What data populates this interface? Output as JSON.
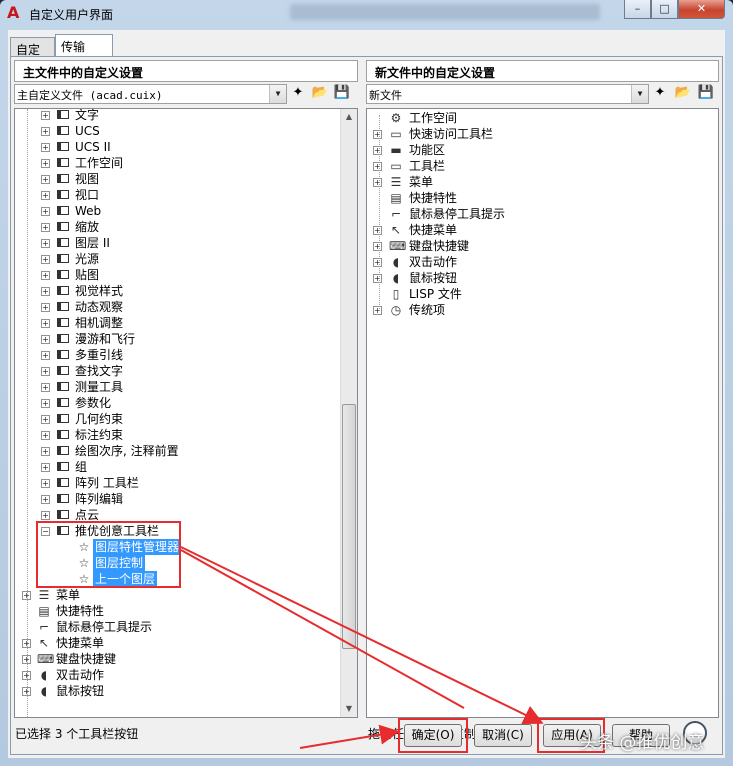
{
  "window": {
    "title": "自定义用户界面",
    "controls": {
      "minimize": "–",
      "maximize": "□",
      "close": "✕"
    }
  },
  "tabs": [
    {
      "label": "自定义",
      "active": false
    },
    {
      "label": "传输",
      "active": true
    }
  ],
  "left": {
    "header": "主文件中的自定义设置",
    "combo_value": "主自定义文件 (acad.cuix)",
    "tree_items": [
      {
        "label": "文字"
      },
      {
        "label": "UCS"
      },
      {
        "label": "UCS II"
      },
      {
        "label": "工作空间"
      },
      {
        "label": "视图"
      },
      {
        "label": "视口"
      },
      {
        "label": "Web"
      },
      {
        "label": "缩放"
      },
      {
        "label": "图层 II"
      },
      {
        "label": "光源"
      },
      {
        "label": "贴图"
      },
      {
        "label": "视觉样式"
      },
      {
        "label": "动态观察"
      },
      {
        "label": "相机调整"
      },
      {
        "label": "漫游和飞行"
      },
      {
        "label": "多重引线"
      },
      {
        "label": "查找文字"
      },
      {
        "label": "测量工具"
      },
      {
        "label": "参数化"
      },
      {
        "label": "几何约束"
      },
      {
        "label": "标注约束"
      },
      {
        "label": "绘图次序, 注释前置"
      },
      {
        "label": "组"
      },
      {
        "label": "阵列 工具栏"
      },
      {
        "label": "阵列编辑"
      },
      {
        "label": "点云"
      },
      {
        "label": "推优创意工具栏"
      }
    ],
    "custom_buttons": [
      {
        "label": "图层特性管理器"
      },
      {
        "label": "图层控制"
      },
      {
        "label": "上一个图层"
      }
    ],
    "bottom_items": [
      {
        "label": "菜单"
      },
      {
        "label": "快捷特性"
      },
      {
        "label": "鼠标悬停工具提示"
      },
      {
        "label": "快捷菜单"
      },
      {
        "label": "键盘快捷键"
      },
      {
        "label": "双击动作"
      },
      {
        "label": "鼠标按钮"
      }
    ],
    "status": "已选择 3 个工具栏按钮"
  },
  "right": {
    "header": "新文件中的自定义设置",
    "combo_value": "新文件",
    "tree_items": [
      {
        "label": "工作空间",
        "icon": "gear-icon",
        "expand": false
      },
      {
        "label": "快速访问工具栏",
        "icon": "toolbar-icon",
        "expand": true
      },
      {
        "label": "功能区",
        "icon": "ribbon-icon",
        "expand": true
      },
      {
        "label": "工具栏",
        "icon": "toolbar-icon",
        "expand": true
      },
      {
        "label": "菜单",
        "icon": "menu-icon",
        "expand": true
      },
      {
        "label": "快捷特性",
        "icon": "properties-icon",
        "expand": false
      },
      {
        "label": "鼠标悬停工具提示",
        "icon": "tooltip-icon",
        "expand": false
      },
      {
        "label": "快捷菜单",
        "icon": "shortcut-menu-icon",
        "expand": true
      },
      {
        "label": "键盘快捷键",
        "icon": "keyboard-icon",
        "expand": true
      },
      {
        "label": "双击动作",
        "icon": "mouse-icon",
        "expand": true
      },
      {
        "label": "鼠标按钮",
        "icon": "mouse-icon",
        "expand": true
      },
      {
        "label": "LISP 文件",
        "icon": "lisp-file-icon",
        "expand": false
      },
      {
        "label": "传统项",
        "icon": "clock-icon",
        "expand": true
      }
    ],
    "status": "拖动任一文件可复制内容"
  },
  "buttons": {
    "ok": "确定(O)",
    "cancel": "取消(C)",
    "apply": "应用(A)",
    "help": "帮助"
  },
  "watermark": "头条 @推优创意",
  "colors": {
    "selection": "#3399ff",
    "highlight_box": "#e62c2c"
  }
}
